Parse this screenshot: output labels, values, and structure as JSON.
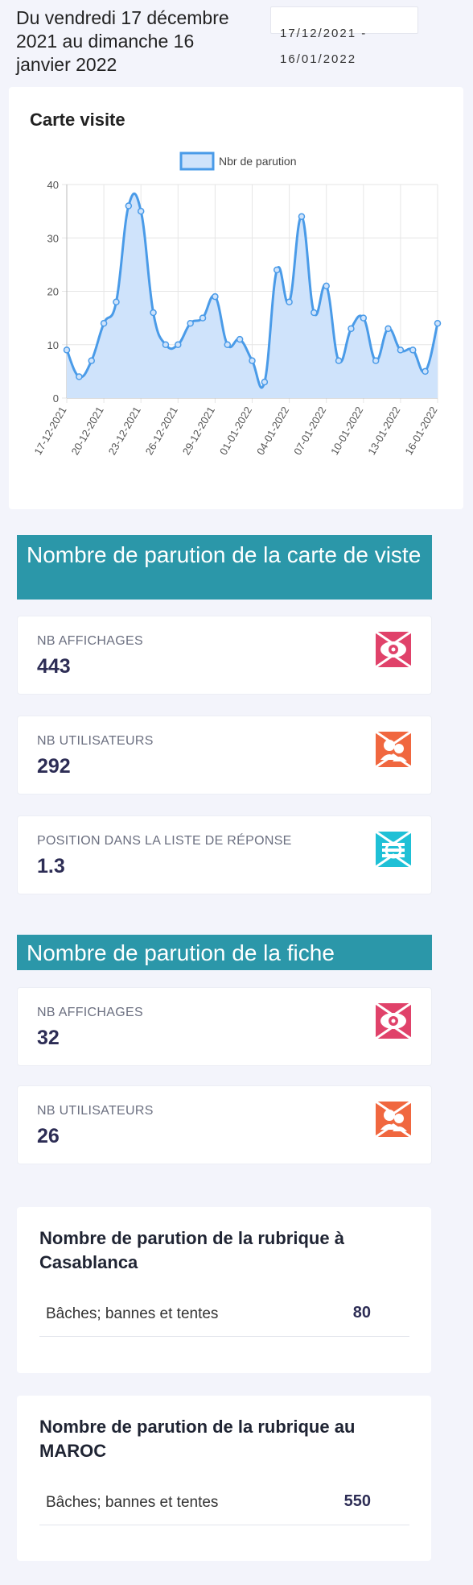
{
  "header": {
    "period_text": "Du vendredi 17 décembre 2021 au dimanche 16 janvier 2022",
    "date_range_value": "17/12/2021 - 16/01/2022"
  },
  "chart_card": {
    "title": "Carte visite"
  },
  "chart_data": {
    "type": "area",
    "title": "",
    "legend": [
      "Nbr de parution"
    ],
    "legend_position": "top",
    "series": [
      {
        "name": "Nbr de parution",
        "color": "#4a9be8",
        "fill": "#cfe3fb",
        "values": [
          9,
          4,
          7,
          14,
          18,
          36,
          35,
          16,
          10,
          10,
          14,
          15,
          19,
          10,
          11,
          7,
          3,
          24,
          18,
          34,
          16,
          21,
          7,
          13,
          15,
          7,
          13,
          9,
          9,
          5,
          14
        ]
      }
    ],
    "x": [
      "17-12-2021",
      "18-12-2021",
      "19-12-2021",
      "20-12-2021",
      "21-12-2021",
      "22-12-2021",
      "23-12-2021",
      "24-12-2021",
      "25-12-2021",
      "26-12-2021",
      "27-12-2021",
      "28-12-2021",
      "29-12-2021",
      "30-12-2021",
      "31-12-2021",
      "01-01-2022",
      "02-01-2022",
      "03-01-2022",
      "04-01-2022",
      "05-01-2022",
      "06-01-2022",
      "07-01-2022",
      "08-01-2022",
      "09-01-2022",
      "10-01-2022",
      "11-01-2022",
      "12-01-2022",
      "13-01-2022",
      "14-01-2022",
      "15-01-2022",
      "16-01-2022"
    ],
    "x_tick_labels": [
      "17-12-2021",
      "20-12-2021",
      "23-12-2021",
      "26-12-2021",
      "29-12-2021",
      "01-01-2022",
      "04-01-2022",
      "07-01-2022",
      "10-01-2022",
      "13-01-2022",
      "16-01-2022"
    ],
    "ylim": [
      0,
      40
    ],
    "y_ticks": [
      "0",
      "10",
      "20",
      "30",
      "40"
    ],
    "grid": true
  },
  "section_carte": {
    "title": "Nombre de parution de la carte de viste",
    "stats": [
      {
        "label": "NB AFFICHAGES",
        "value": "443",
        "icon": "eye-icon",
        "color": "#e0426a"
      },
      {
        "label": "NB UTILISATEURS",
        "value": "292",
        "icon": "users-icon",
        "color": "#f0673f"
      },
      {
        "label": "POSITION DANS LA LISTE DE RÉPONSE",
        "value": "1.3",
        "icon": "list-position-icon",
        "color": "#1fc0d6"
      }
    ]
  },
  "section_fiche": {
    "title": "Nombre de parution de la fiche",
    "stats": [
      {
        "label": "NB AFFICHAGES",
        "value": "32",
        "icon": "eye-icon",
        "color": "#e0426a"
      },
      {
        "label": "NB UTILISATEURS",
        "value": "26",
        "icon": "users-icon",
        "color": "#f0673f"
      }
    ]
  },
  "rubrique_casablanca": {
    "title": "Nombre de parution de la rubrique à Casablanca",
    "rows": [
      {
        "name": "Bâches; bannes et tentes",
        "value": "80"
      }
    ]
  },
  "rubrique_maroc": {
    "title": "Nombre de parution de la rubrique au MAROC",
    "rows": [
      {
        "name": "Bâches; bannes et tentes",
        "value": "550"
      }
    ]
  }
}
